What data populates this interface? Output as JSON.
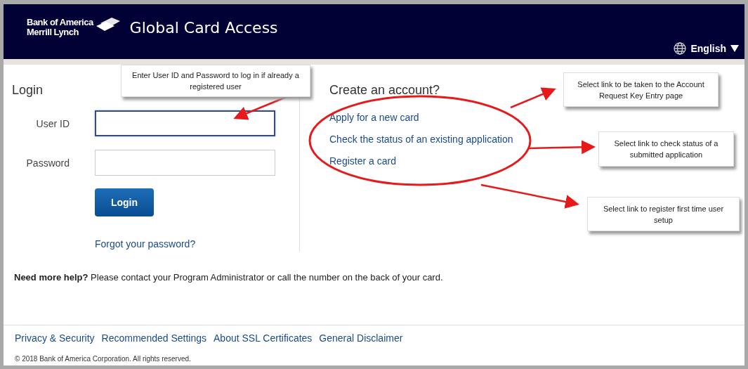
{
  "header": {
    "logo_lines": [
      "Bank of America",
      "Merrill Lynch"
    ],
    "title": "Global Card Access",
    "language": "English"
  },
  "login": {
    "heading": "Login",
    "fields": [
      {
        "label": "User ID",
        "focused": true
      },
      {
        "label": "Password",
        "focused": false
      }
    ],
    "button": "Login",
    "forgot_link": "Forgot your password?"
  },
  "create_account": {
    "heading": "Create an account?",
    "links": [
      "Apply for a new card",
      "Check the status of an existing application",
      "Register a card"
    ]
  },
  "help": {
    "label": "Need more help?",
    "text": "Please contact your Program Administrator or call the number on the back of your card."
  },
  "footer": {
    "links": [
      "Privacy & Security",
      "Recommended Settings",
      "About SSL Certificates",
      "General Disclaimer"
    ],
    "copyright": "© 2018 Bank of America Corporation. All rights reserved."
  },
  "annotations": [
    {
      "text": "Enter User ID and Password to log in if already a registered user"
    },
    {
      "text": "Select link to be taken to the Account Request Key Entry page"
    },
    {
      "text": "Select link to check status of a submitted application"
    },
    {
      "text": "Select link to register first time user setup"
    }
  ]
}
